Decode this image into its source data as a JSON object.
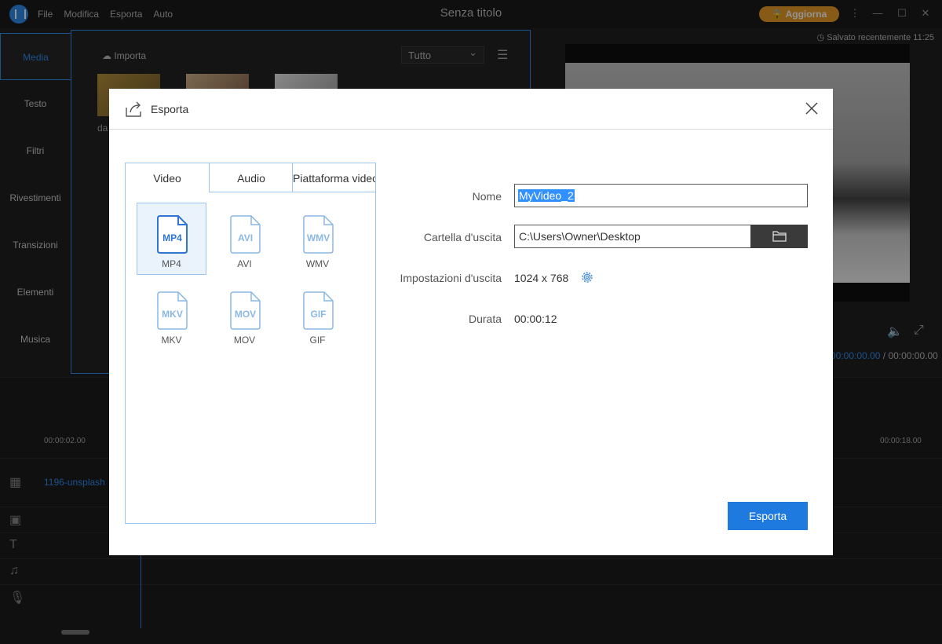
{
  "app": {
    "window_title": "Senza titolo",
    "menu": [
      "File",
      "Modifica",
      "Esporta",
      "Auto"
    ],
    "upgrade_label": "Aggiorna",
    "saved_status": "Salvato recentemente 11:25"
  },
  "left_nav": {
    "items": [
      "Media",
      "Testo",
      "Filtri",
      "Rivestimenti",
      "Transizioni",
      "Elementi",
      "Musica"
    ]
  },
  "media_panel": {
    "import_label": "Importa",
    "filter_value": "Tutto",
    "thumb_caption": "da"
  },
  "preview": {
    "current_time": "00:00:00.00",
    "separator": "/",
    "total_time": "00:00:00.00"
  },
  "timeline": {
    "ruler_start": "00:00:02.00",
    "ruler_end": "00:00:18.00",
    "clip_label": "1196-unsplash"
  },
  "dialog": {
    "title": "Esporta",
    "tabs": [
      "Video",
      "Audio",
      "Piattaforma video"
    ],
    "formats": [
      {
        "badge": "MP4",
        "label": "MP4"
      },
      {
        "badge": "AVI",
        "label": "AVI"
      },
      {
        "badge": "WMV",
        "label": "WMV"
      },
      {
        "badge": "MKV",
        "label": "MKV"
      },
      {
        "badge": "MOV",
        "label": "MOV"
      },
      {
        "badge": "GIF",
        "label": "GIF"
      }
    ],
    "fields": {
      "name_label": "Nome",
      "name_value": "MyVideo_2",
      "folder_label": "Cartella d'uscita",
      "folder_value": "C:\\Users\\Owner\\Desktop",
      "settings_label": "Impostazioni d'uscita",
      "settings_value": "1024 x 768",
      "duration_label": "Durata",
      "duration_value": "00:00:12"
    },
    "export_button": "Esporta"
  },
  "colors": {
    "accent": "#1f7ae0",
    "upgrade": "#e89b28",
    "format_selected": "#2d76d2",
    "format_unselected": "#8ab8e4"
  }
}
